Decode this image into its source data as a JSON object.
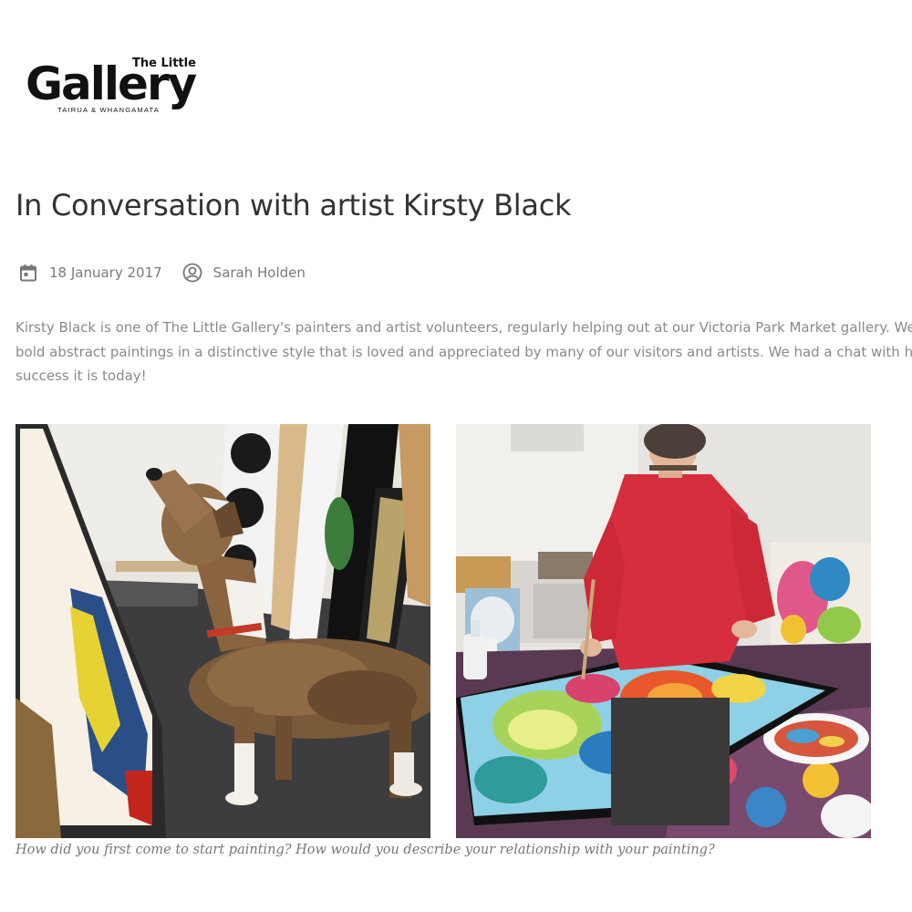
{
  "logo": {
    "small_text": "The Little",
    "main_text": "Gallery",
    "tagline": "TAIRUA & WHANGAMATA"
  },
  "post": {
    "title": "In Conversation with artist Kirsty Black",
    "date": "18 January 2017",
    "author": "Sarah Holden",
    "intro_lines": [
      "Kirsty Black is one of The Little Gallery's painters and artist volunteers, regularly helping out at our Victoria Park Market gallery. We",
      "bold abstract paintings in a distinctive style that is loved and appreciated by many of our visitors and artists. We had a chat with h",
      "success it is today!"
    ],
    "caption": "How did you first come to start painting? How would you describe your relationship with your painting?"
  },
  "icons": {
    "date": "calendar-icon",
    "author": "user-circle-icon"
  },
  "colors": {
    "meta_text": "#7a7a7a",
    "body_text": "#8a8a8a",
    "title_text": "#333333"
  }
}
